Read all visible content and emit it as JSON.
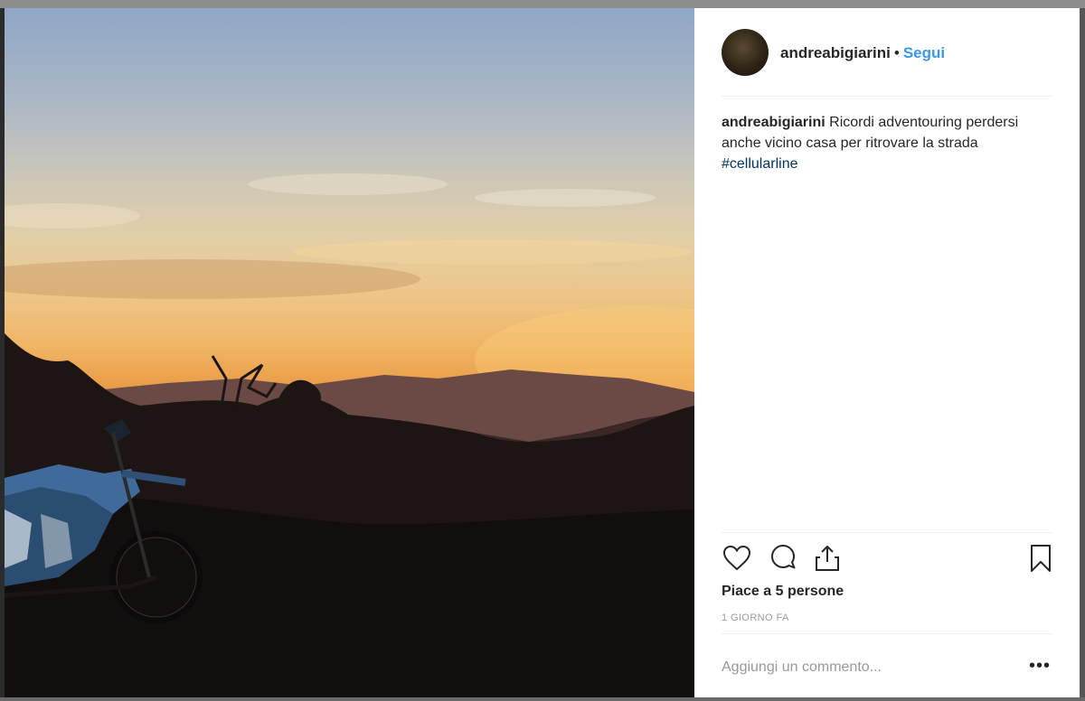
{
  "post": {
    "username": "andreabigiarini",
    "separator": "•",
    "follow_label": "Segui",
    "caption": {
      "username": "andreabigiarini",
      "text": "Ricordi adventouring perdersi anche vicino casa per ritrovare la strada",
      "hashtag": "#cellularline"
    },
    "likes_text": "Piace a 5 persone",
    "timestamp": "1 GIORNO FA",
    "comment_placeholder": "Aggiungi un commento...",
    "more_label": "•••"
  },
  "icons": {
    "like": "heart-icon",
    "comment": "comment-bubble-icon",
    "share": "share-icon",
    "save": "bookmark-icon"
  },
  "colors": {
    "link": "#3897f0",
    "hashtag": "#003569",
    "text": "#262626",
    "muted": "#999999"
  }
}
